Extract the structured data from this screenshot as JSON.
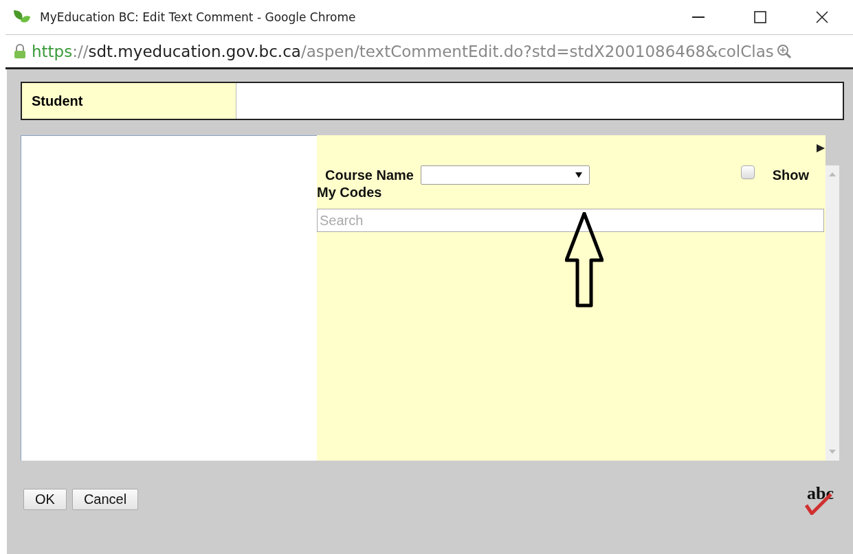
{
  "window": {
    "title": "MyEducation BC: Edit Text Comment - Google Chrome"
  },
  "address_bar": {
    "scheme": "https",
    "separator": "://",
    "host": "sdt.myeducation.gov.bc.ca",
    "path": "/aspen/textCommentEdit.do?std=stdX2001086468&colClas"
  },
  "student": {
    "label": "Student"
  },
  "filters": {
    "course_label": "Course Name",
    "show_label": "Show",
    "show_checked": false,
    "my_codes_label": "My Codes",
    "search": {
      "placeholder": "Search"
    }
  },
  "buttons": [
    {
      "label": "OK"
    },
    {
      "label": "Cancel"
    }
  ],
  "spellcheck": {
    "text": "abc"
  }
}
